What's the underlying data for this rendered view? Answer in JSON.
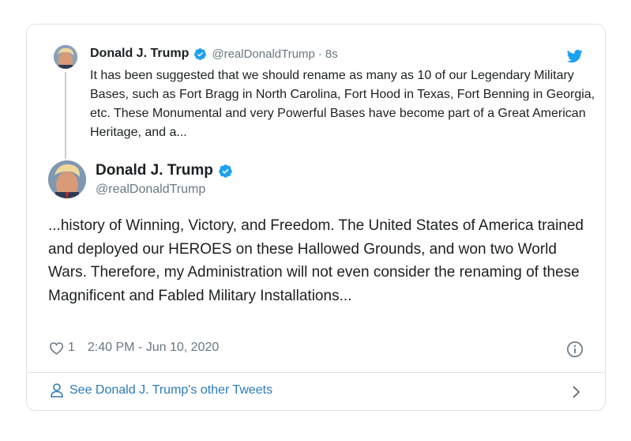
{
  "parent_tweet": {
    "author_name": "Donald J. Trump",
    "handle": "@realDonaldTrump",
    "separator": "·",
    "time": "8s",
    "text": "It has been suggested that we should rename as many as 10 of our Legendary Military Bases, such as Fort Bragg in North Carolina, Fort Hood in Texas, Fort Benning in Georgia, etc. These Monumental and very Powerful Bases have become part of a Great American Heritage, and a..."
  },
  "main_tweet": {
    "author_name": "Donald J. Trump",
    "handle": "@realDonaldTrump",
    "text": "...history of Winning, Victory, and Freedom. The United States of America trained and deployed our HEROES on these Hallowed Grounds, and won two World Wars. Therefore, my Administration will not even consider the renaming of these Magnificent and Fabled Military Installations...",
    "like_count": "1",
    "timestamp": "2:40 PM - Jun 10, 2020"
  },
  "footer": {
    "link_label": "See Donald J. Trump's other Tweets"
  },
  "icons": {
    "brand": "twitter-bird-icon",
    "verified": "verified-badge-icon",
    "like": "heart-icon",
    "info": "info-icon",
    "profile": "person-icon",
    "more": "chevron-right-icon"
  },
  "colors": {
    "twitter_blue": "#1da1f2",
    "link_blue": "#2b7bb9",
    "secondary_text": "#697882",
    "border": "#dde3e8"
  }
}
